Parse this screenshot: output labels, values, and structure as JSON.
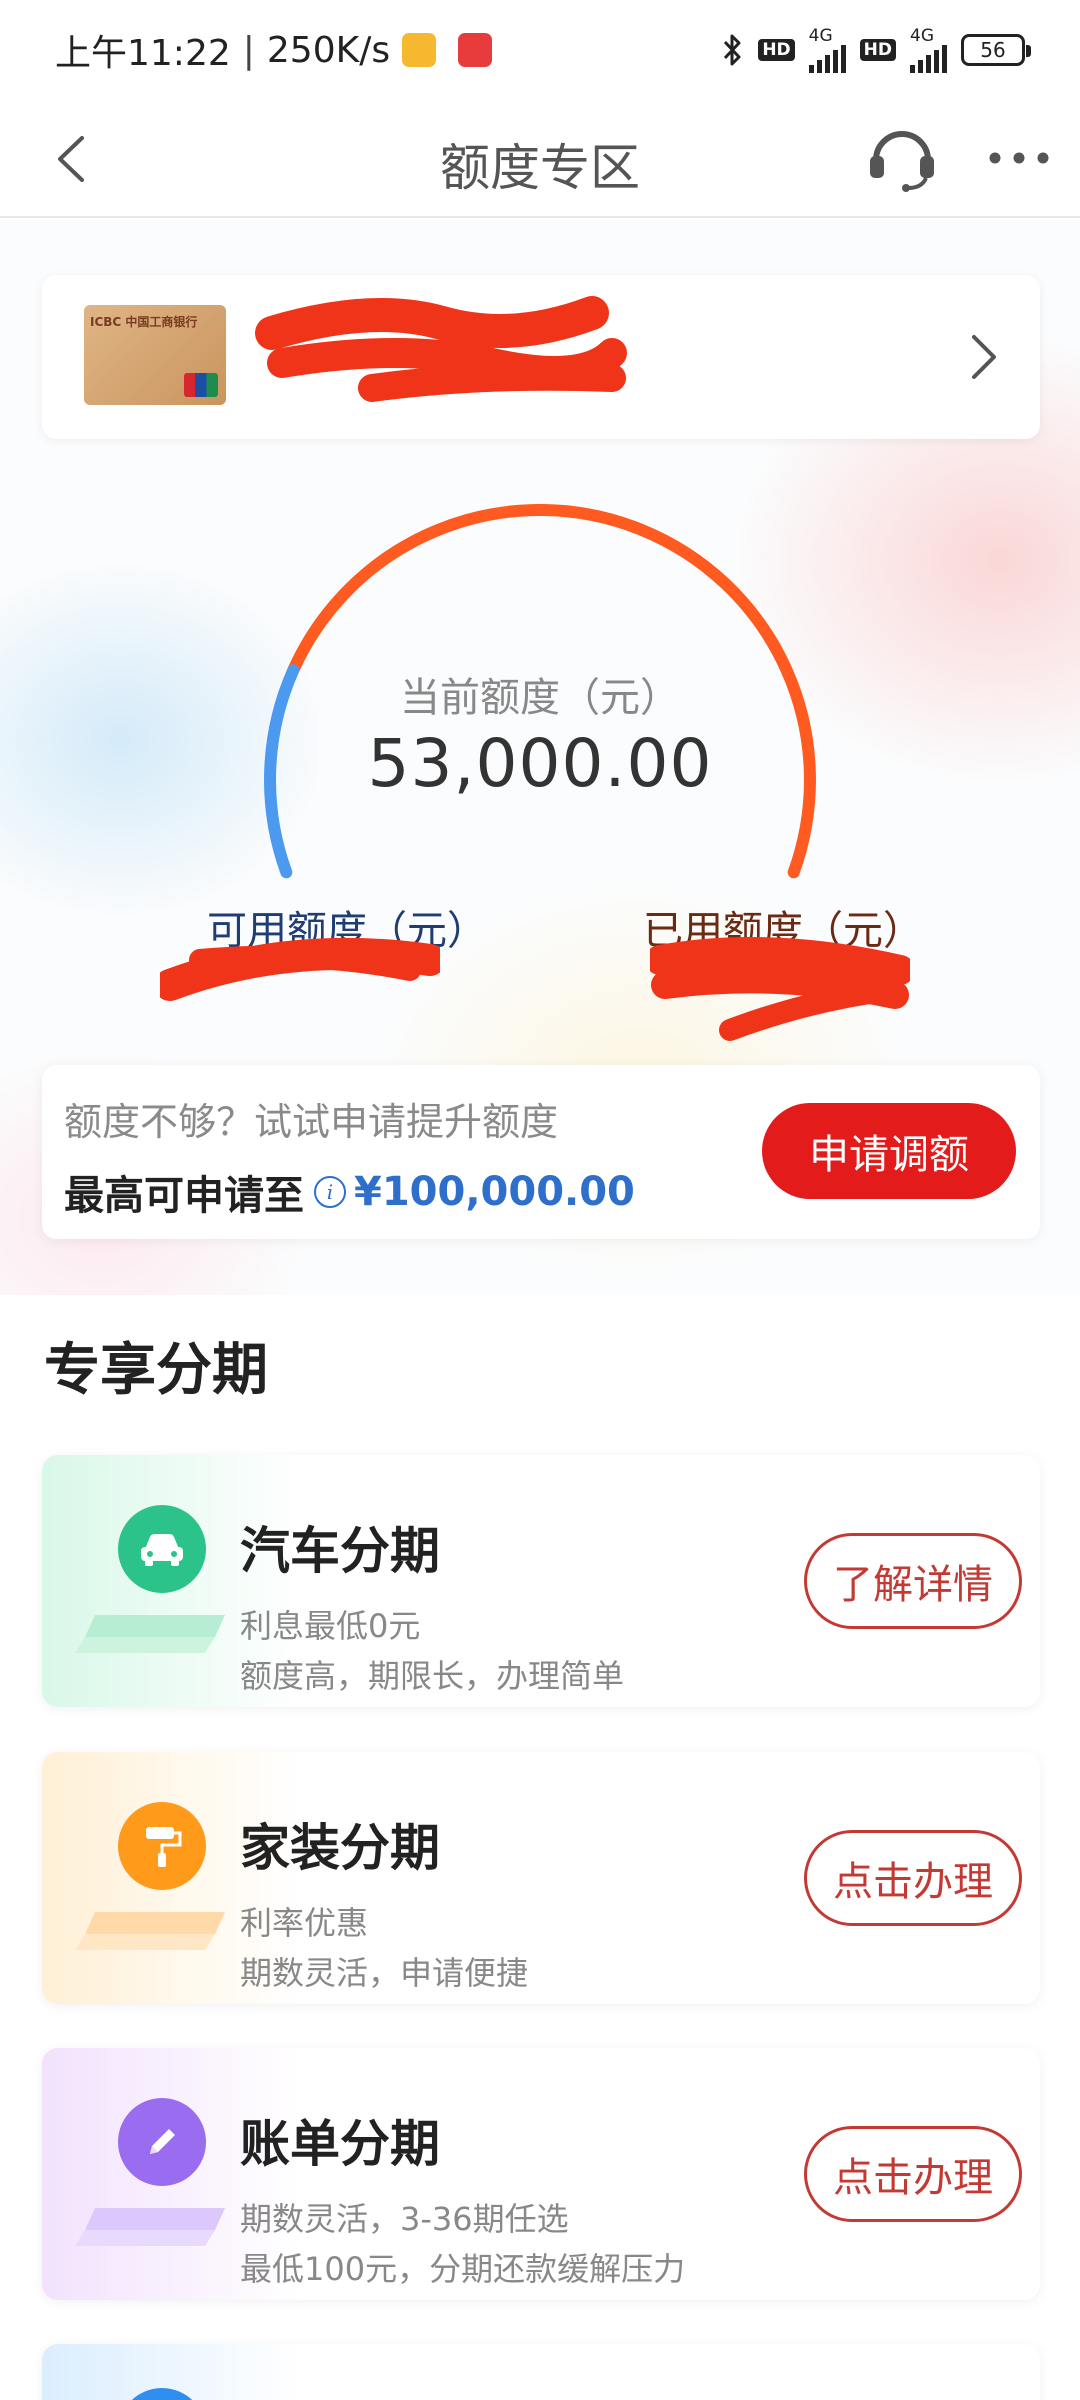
{
  "status_bar": {
    "time": "上午11:22",
    "network_speed": "250K/s",
    "bluetooth_icon": "bluetooth-icon",
    "hd_label": "HD",
    "network_label": "4G",
    "battery_level": "56"
  },
  "nav": {
    "title": "额度专区",
    "back_icon": "chevron-left-icon",
    "support_icon": "headset-icon",
    "more_icon": "more-icon"
  },
  "card": {
    "thumb_label": "ICBC 中国工商银行"
  },
  "gauge": {
    "label": "当前额度（元）",
    "value": "53,000.00",
    "available_fraction": 0.2,
    "available_color": "#4b9af0",
    "used_color": "#ff5a1f",
    "available_label": "可用额度（元）",
    "used_label": "已用额度（元）"
  },
  "apply": {
    "hint": "额度不够？试试申请提升额度",
    "max_label": "最高可申请至",
    "max_amount": "¥100,000.00",
    "button_label": "申请调额",
    "accent_color": "#e31b1b"
  },
  "section": {
    "title": "专享分期"
  },
  "installments": [
    {
      "title": "汽车分期",
      "line1": "利息最低0元",
      "line2": "额度高，期限长，办理简单",
      "button_label": "了解详情",
      "icon": "car-icon",
      "color": "#2cc38a"
    },
    {
      "title": "家装分期",
      "line1": "利率优惠",
      "line2": "期数灵活，申请便捷",
      "button_label": "点击办理",
      "icon": "paint-roller-icon",
      "color": "#ff9a1a"
    },
    {
      "title": "账单分期",
      "line1": "期数灵活，3-36期任选",
      "line2": "最低100元，分期还款缓解压力",
      "button_label": "点击办理",
      "icon": "pencil-icon",
      "color": "#9a6cf0"
    }
  ]
}
